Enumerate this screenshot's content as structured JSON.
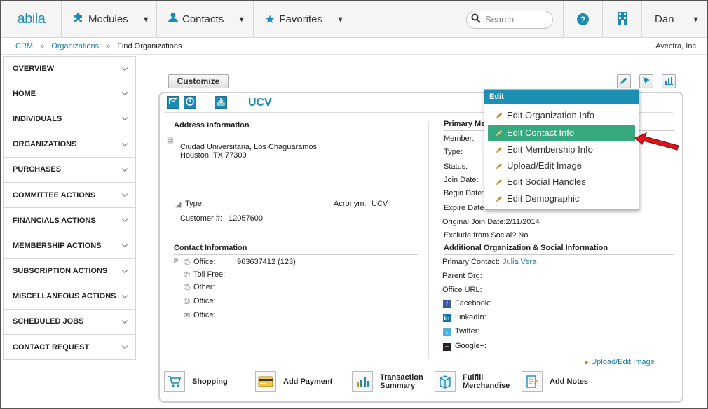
{
  "app": {
    "logo": "abila"
  },
  "nav": {
    "items": [
      {
        "label": "Modules",
        "icon": "puzzle-icon"
      },
      {
        "label": "Contacts",
        "icon": "person-icon"
      },
      {
        "label": "Favorites",
        "icon": "star-icon"
      }
    ],
    "search_placeholder": "Search",
    "user": "Dan"
  },
  "breadcrumb": {
    "crm": "CRM",
    "organizations": "Organizations",
    "current": "Find Organizations",
    "company": "Avectra, Inc."
  },
  "sidebar": {
    "items": [
      {
        "label": "OVERVIEW"
      },
      {
        "label": "HOME"
      },
      {
        "label": "INDIVIDUALS"
      },
      {
        "label": "ORGANIZATIONS"
      },
      {
        "label": "PURCHASES"
      },
      {
        "label": "COMMITTEE ACTIONS"
      },
      {
        "label": "FINANCIALS ACTIONS"
      },
      {
        "label": "MEMBERSHIP ACTIONS"
      },
      {
        "label": "SUBSCRIPTION ACTIONS"
      },
      {
        "label": "MISCELLANEOUS ACTIONS"
      },
      {
        "label": "SCHEDULED JOBS"
      },
      {
        "label": "CONTACT REQUEST"
      }
    ]
  },
  "toolbar": {
    "customize": "Customize"
  },
  "org": {
    "title": "UCV",
    "address_header": "Address Information",
    "address_line1": "Ciudad Universitaria, Los Chaguaramos",
    "address_line2": "Houston, TX 77300",
    "type_label": "Type:",
    "acronym_label": "Acronym:",
    "acronym_value": "UCV",
    "customer_label": "Customer #:",
    "customer_value": "12057600",
    "contact_header": "Contact Information",
    "phone_marker": "P",
    "office_label": "Office:",
    "office_value": "963637412 (123)",
    "tollfree_label": "Toll Free:",
    "other_label": "Other:",
    "office2_label": "Office:",
    "office3_label": "Office:"
  },
  "membership": {
    "header": "Primary Me",
    "member_label": "Member:",
    "type_label": "Type:",
    "status_label": "Status:",
    "join_label": "Join Date:",
    "begin_label": "Begin Date:",
    "expire_label": "Expire Date:",
    "orig_join": "Original Join Date:2/11/2014",
    "exclude_social": "Exclude from Social? No"
  },
  "additional": {
    "header": "Additional Organization & Social Information",
    "primary_contact_label": "Primary Contact:",
    "primary_contact_value": "Julia Vera",
    "parent_org": "Parent Org:",
    "office_url": "Office URL:",
    "facebook": "Facebook:",
    "linkedin": "LinkedIn:",
    "twitter": "Twitter:",
    "googleplus": "Google+:",
    "upload_link": "Upload/Edit Image"
  },
  "actions": [
    {
      "label": "Shopping"
    },
    {
      "label": "Add Payment"
    },
    {
      "label": "Transaction Summary"
    },
    {
      "label": "Fulfill Merchandise"
    },
    {
      "label": "Add Notes"
    }
  ],
  "edit_menu": {
    "header": "Edit",
    "items": [
      "Edit Organization Info",
      "Edit Contact Info",
      "Edit Membership Info",
      "Upload/Edit Image",
      "Edit Social Handles",
      "Edit Demographic"
    ]
  },
  "colors": {
    "accent": "#1b8bb0",
    "selected": "#36a97f",
    "arrow": "#e0141b"
  }
}
